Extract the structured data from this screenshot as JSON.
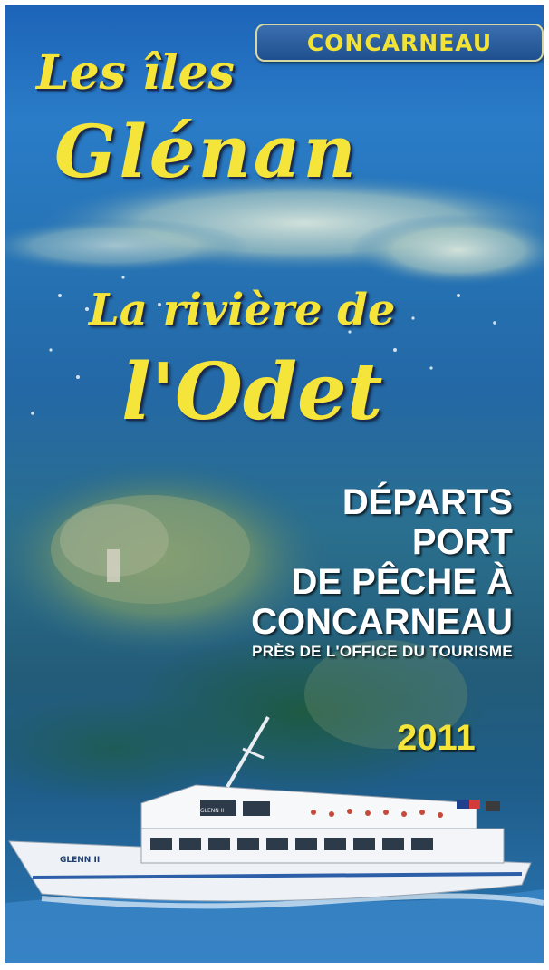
{
  "badge": {
    "label": "CONCARNEAU"
  },
  "title": {
    "line1": "Les îles",
    "line2": "Glénan",
    "line3": "La rivière de",
    "line4": "l'Odet"
  },
  "departures": {
    "line1": "Départs",
    "line2": "Port",
    "line3": "de pêche à",
    "line4": "Concarneau",
    "note": "Près de l'office du tourisme"
  },
  "year": "2011",
  "boat": {
    "name": "GLENN II"
  },
  "colors": {
    "title_yellow": "#f5e43a",
    "sea_blue": "#2674b6",
    "badge_blue": "#2b5e9e"
  }
}
